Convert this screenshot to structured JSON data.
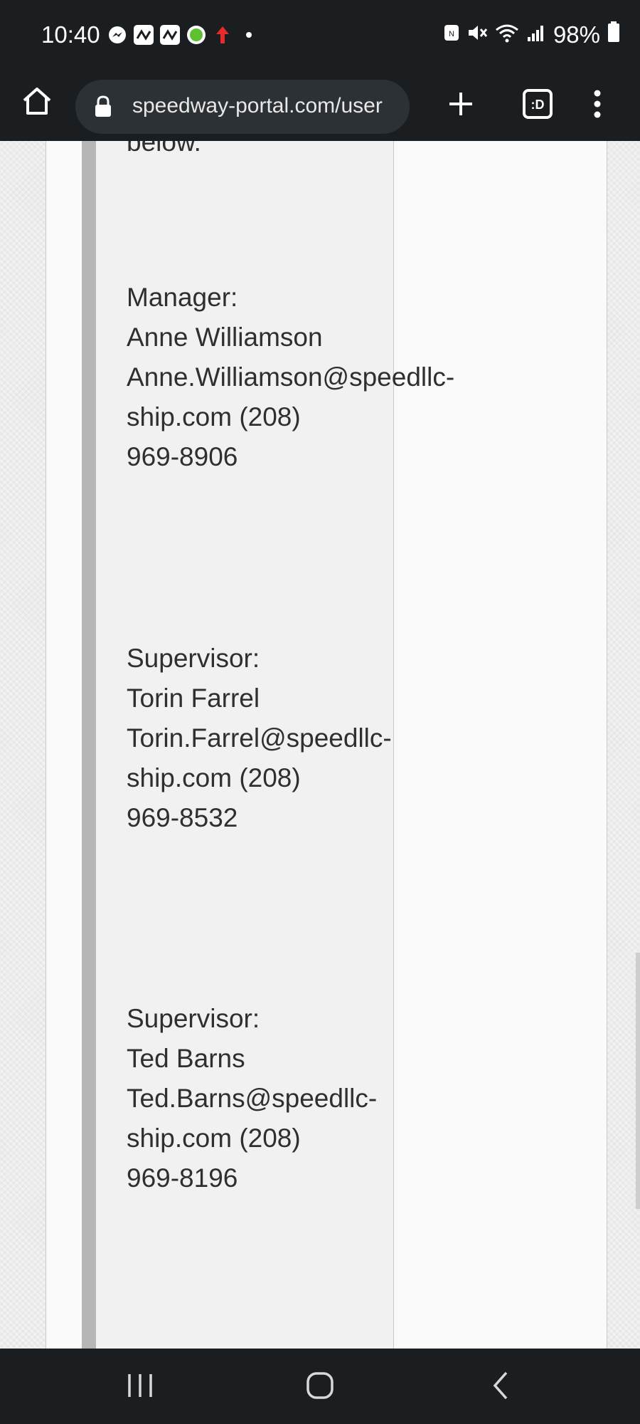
{
  "status_bar": {
    "time": "10:40",
    "battery": "98%",
    "notification_icons": [
      "messenger-icon",
      "activity-icon",
      "activity-icon",
      "green-dot-icon",
      "upload-arrow-icon",
      "dot-icon"
    ],
    "system_icons": [
      "nfc-icon",
      "mute-icon",
      "wifi-icon",
      "signal-icon",
      "battery-icon"
    ]
  },
  "browser": {
    "url": "speedway-portal.com/user"
  },
  "content": {
    "intro_tail": "below.",
    "contacts": [
      {
        "role": "Manager:",
        "name": "Anne Williamson",
        "email_line": "Anne.Williamson@speedllc-",
        "email_phone_line": "ship.com (208)",
        "phone_tail": "969-8906"
      },
      {
        "role": "Supervisor:",
        "name": "Torin Farrel",
        "email_line": "Torin.Farrel@speedllc-",
        "email_phone_line": "ship.com (208)",
        "phone_tail": "969-8532"
      },
      {
        "role": "Supervisor:",
        "name": "Ted Barns",
        "email_line": "Ted.Barns@speedllc-",
        "email_phone_line": "ship.com (208)",
        "phone_tail": "969-8196"
      }
    ]
  },
  "colors": {
    "chrome_bg": "#1b1e21",
    "url_pill": "#2c3136",
    "text": "#2f2f2f",
    "column_bg": "#f1f1f1"
  }
}
